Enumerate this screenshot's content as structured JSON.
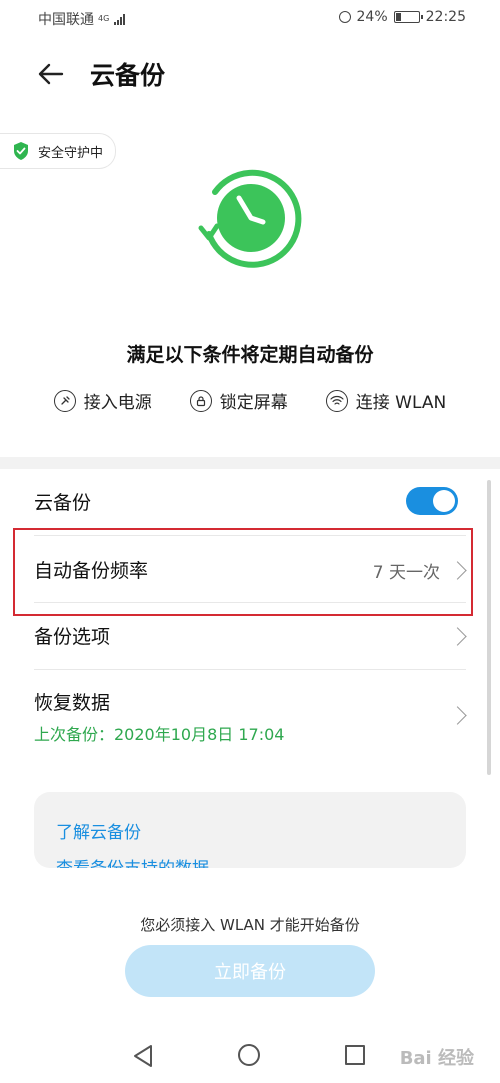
{
  "status_bar": {
    "carrier": "中国联通",
    "network": "4G",
    "battery_percent": "24%",
    "battery_level": 0.24,
    "time": "22:25"
  },
  "header": {
    "title": "云备份"
  },
  "security_badge": {
    "label": "安全守护中"
  },
  "conditions": {
    "title": "满足以下条件将定期自动备份",
    "items": [
      {
        "label": "接入电源",
        "icon": "power-plug-icon"
      },
      {
        "label": "锁定屏幕",
        "icon": "lock-icon"
      },
      {
        "label": "连接 WLAN",
        "icon": "wifi-icon"
      }
    ]
  },
  "settings": {
    "cloud_backup": {
      "label": "云备份",
      "enabled": true
    },
    "auto_frequency": {
      "label": "自动备份频率",
      "value": "7 天一次"
    },
    "backup_options": {
      "label": "备份选项"
    },
    "restore_data": {
      "label": "恢复数据",
      "sub": "上次备份：2020年10月8日 17:04"
    }
  },
  "info_card": {
    "link_learn": "了解云备份",
    "link_data": "查看备份支持的数据"
  },
  "footer": {
    "notice": "您必须接入 WLAN 才能开始备份",
    "backup_button": "立即备份"
  },
  "watermark": "Bai 经验",
  "colors": {
    "accent_blue": "#1a8fe0",
    "green": "#2fa84f",
    "highlight_red": "#d42a33",
    "button_disabled": "#c2e4f8"
  }
}
